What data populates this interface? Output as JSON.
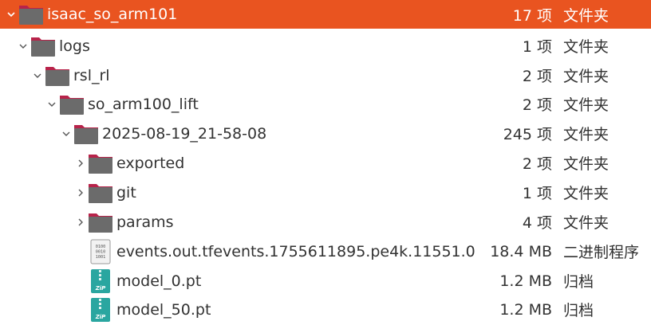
{
  "items": [
    {
      "name": "isaac_so_arm101",
      "size": "17 项",
      "type": "文件夹",
      "icon": "folder-icon",
      "expander": "chevron-down-icon",
      "selected": true
    },
    {
      "name": "logs",
      "size": "1 项",
      "type": "文件夹",
      "icon": "folder-icon",
      "expander": "chevron-down-icon"
    },
    {
      "name": "rsl_rl",
      "size": "2 项",
      "type": "文件夹",
      "icon": "folder-icon",
      "expander": "chevron-down-icon"
    },
    {
      "name": "so_arm100_lift",
      "size": "2 项",
      "type": "文件夹",
      "icon": "folder-icon",
      "expander": "chevron-down-icon"
    },
    {
      "name": "2025-08-19_21-58-08",
      "size": "245 项",
      "type": "文件夹",
      "icon": "folder-icon",
      "expander": "chevron-down-icon"
    },
    {
      "name": "exported",
      "size": "2 项",
      "type": "文件夹",
      "icon": "folder-icon",
      "expander": "chevron-right-icon"
    },
    {
      "name": "git",
      "size": "1 项",
      "type": "文件夹",
      "icon": "folder-icon",
      "expander": "chevron-right-icon"
    },
    {
      "name": "params",
      "size": "4 项",
      "type": "文件夹",
      "icon": "folder-icon",
      "expander": "chevron-right-icon"
    },
    {
      "name": "events.out.tfevents.1755611895.pe4k.11551.0",
      "size": "18.4 MB",
      "type": "二进制程序",
      "icon": "binary-file-icon"
    },
    {
      "name": "model_0.pt",
      "size": "1.2 MB",
      "type": "归档",
      "icon": "zip-archive-icon"
    },
    {
      "name": "model_50.pt",
      "size": "1.2 MB",
      "type": "归档",
      "icon": "zip-archive-icon"
    }
  ],
  "icon_labels": {
    "binary": [
      "0100",
      "0010",
      "1001"
    ],
    "zip": "ZiP"
  },
  "colors": {
    "selection": "#e95420",
    "folder_body": "#6b6b6b",
    "folder_tab": "#b8234a",
    "text": "#323232",
    "archive": "#2aa6a0"
  }
}
